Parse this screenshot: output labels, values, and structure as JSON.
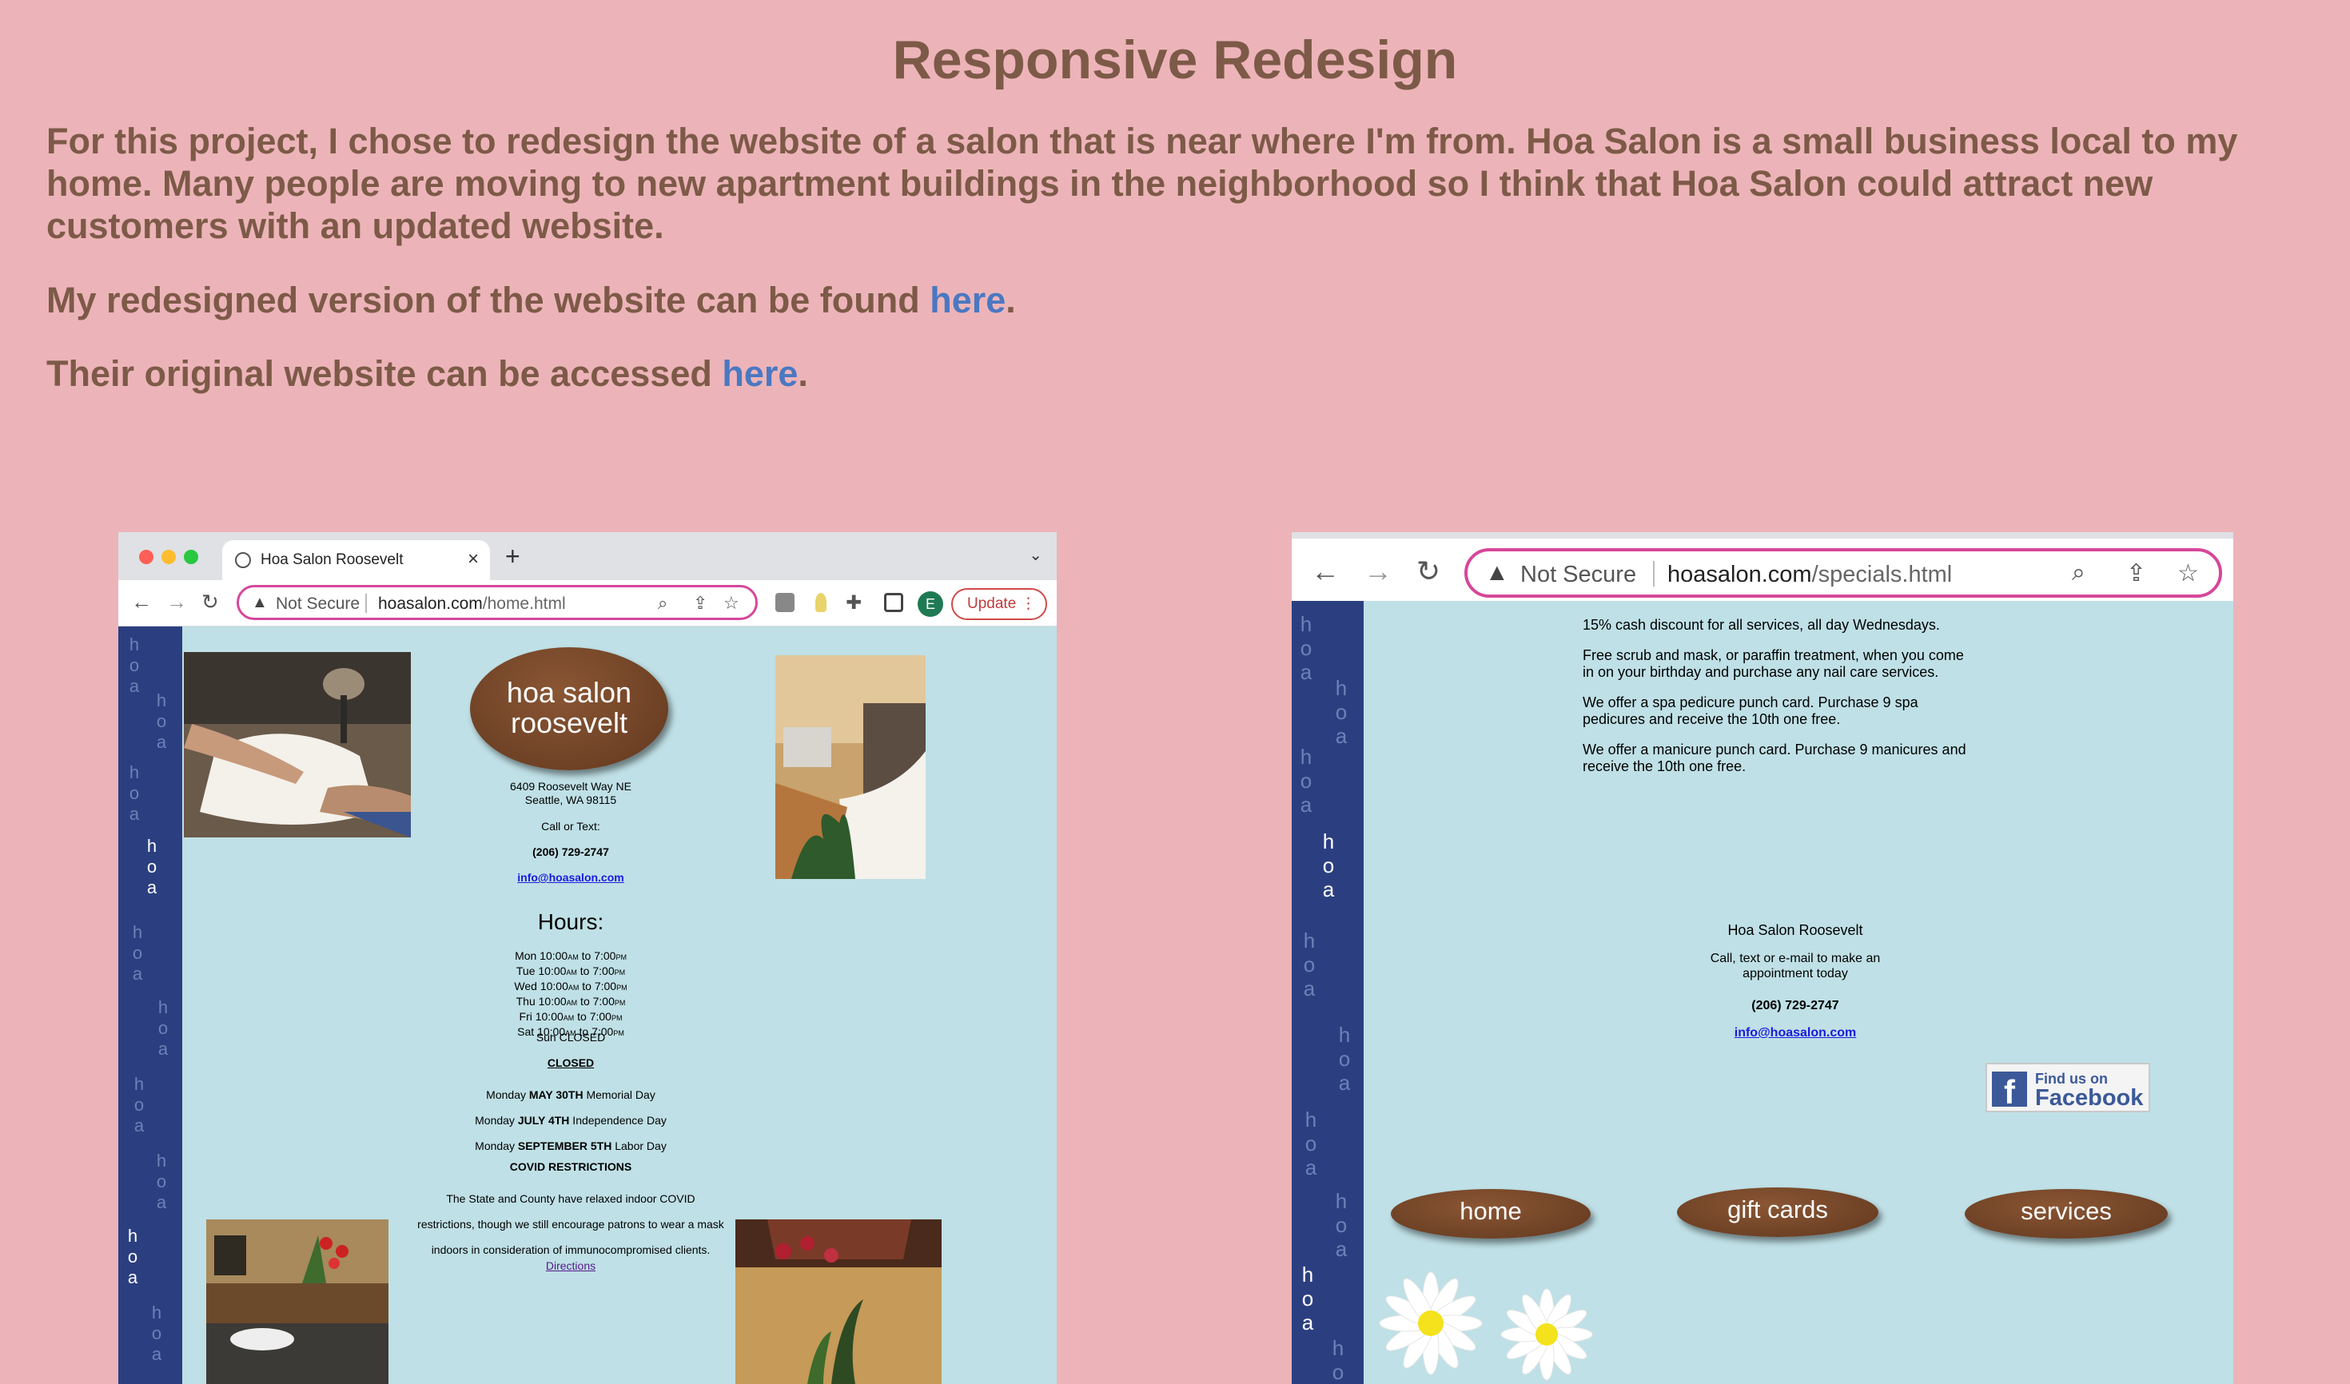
{
  "heading": "Responsive Redesign",
  "intro": "For this project, I chose to redesign the website of a salon that is near where I'm from. Hoa Salon is a small business local to my home. Many people are moving to new apartment buildings in the neighborhood so I think that Hoa Salon could attract new customers with an updated website.",
  "redesign_line": {
    "prefix": "My redesigned version of the website can be found ",
    "link": "here",
    "suffix": "."
  },
  "original_line": {
    "prefix": "Their original website can be accessed ",
    "link": "here",
    "suffix": "."
  },
  "left_browser": {
    "tab_title": "Hoa Salon Roosevelt",
    "tab_close": "×",
    "new_tab": "+",
    "tab_menu": "⌄",
    "not_secure": "Not Secure",
    "url_host": "hoasalon.com",
    "url_path": "/home.html",
    "update_label": "Update",
    "avatar_letter": "E",
    "logo_line1": "hoa salon",
    "logo_line2": "roosevelt",
    "address1": "6409 Roosevelt Way NE",
    "address2": "Seattle, WA 98115",
    "call": "Call or Text:",
    "phone": "(206) 729-2747",
    "email": "info@hoasalon.com",
    "hours_title": "Hours:",
    "hours": [
      {
        "day": "Mon",
        "open": "10:00",
        "close": "7:00"
      },
      {
        "day": "Tue",
        "open": "10:00",
        "close": "7:00"
      },
      {
        "day": "Wed",
        "open": "10:00",
        "close": "7:00"
      },
      {
        "day": "Thu",
        "open": "10:00",
        "close": "7:00"
      },
      {
        "day": "Fri",
        "open": "10:00",
        "close": "7:00"
      },
      {
        "day": "Sat",
        "open": "10:00",
        "close": "7:00"
      }
    ],
    "am": "AM",
    "to": "to",
    "pm": "PM",
    "sunday": "Sun CLOSED",
    "closed_title": "CLOSED",
    "holidays": [
      {
        "pre": "Monday ",
        "date": "MAY 30TH",
        "post": " Memorial Day"
      },
      {
        "pre": "Monday ",
        "date": "JULY 4TH",
        "post": " Independence Day"
      },
      {
        "pre": "Monday ",
        "date": "SEPTEMBER 5TH",
        "post": " Labor Day"
      }
    ],
    "covid_title": "COVID RESTRICTIONS",
    "covid_lines": [
      "The State and County have relaxed indoor COVID",
      "restrictions, though we still encourage patrons to wear a mask",
      "indoors in consideration of immunocompromised clients."
    ],
    "directions": "Directions"
  },
  "right_browser": {
    "not_secure": "Not Secure",
    "url_host": "hoasalon.com",
    "url_path": "/specials.html",
    "specials": [
      [
        "15% cash discount for all services, all day Wednesdays."
      ],
      [
        "Free scrub and mask, or paraffin treatment, when you come",
        "in on your birthday and purchase any nail care services."
      ],
      [
        "We offer a spa pedicure punch card. Purchase 9 spa",
        "pedicures and receive the 10th one free."
      ],
      [
        "We offer a manicure punch card. Purchase 9 manicures and",
        "receive the 10th one free."
      ]
    ],
    "salon_name": "Hoa Salon Roosevelt",
    "call_line1": "Call, text or e-mail to make an",
    "call_line2": "appointment today",
    "phone": "(206) 729-2747",
    "email": "info@hoasalon.com",
    "fb_line1": "Find us on",
    "fb_line2": "Facebook",
    "nav_buttons": [
      "home",
      "gift cards",
      "services"
    ]
  },
  "strip_word": "hoa",
  "colors": {
    "background": "#ecb4b8",
    "text": "#7d5a48",
    "link": "#4a78c2",
    "strip": "#2b3f80",
    "site_bg": "#bfe0e6",
    "oval": "#6e4125"
  }
}
